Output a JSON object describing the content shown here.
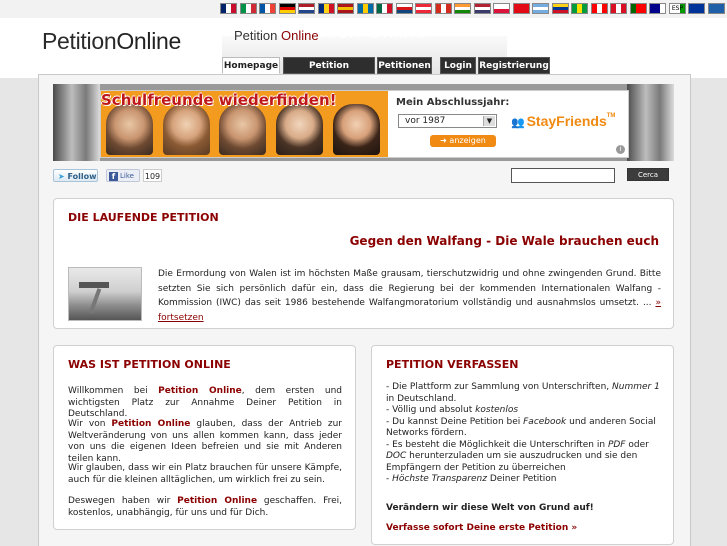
{
  "flags": [
    {
      "name": "uk-flag",
      "colors": [
        "#012169",
        "#ffffff",
        "#c8102e"
      ]
    },
    {
      "name": "italy-flag",
      "colors": [
        "#009246",
        "#ffffff",
        "#ce2b37"
      ]
    },
    {
      "name": "france-flag",
      "colors": [
        "#0055a4",
        "#ffffff",
        "#ef4135"
      ]
    },
    {
      "name": "germany-flag",
      "colors": [
        "#000000",
        "#dd0000",
        "#ffce00"
      ],
      "horizontal": true
    },
    {
      "name": "netherlands-flag",
      "colors": [
        "#ae1c28",
        "#ffffff",
        "#21468b"
      ],
      "horizontal": true
    },
    {
      "name": "romania-flag",
      "colors": [
        "#002b7f",
        "#fcd116",
        "#ce1126"
      ]
    },
    {
      "name": "spain-flag",
      "colors": [
        "#aa151b",
        "#f1bf00",
        "#aa151b"
      ],
      "horizontal": true
    },
    {
      "name": "sweden-flag",
      "colors": [
        "#006aa7",
        "#fecc00",
        "#006aa7"
      ]
    },
    {
      "name": "mexico-flag",
      "colors": [
        "#006847",
        "#ffffff",
        "#ce1126"
      ]
    },
    {
      "name": "czech-flag",
      "colors": [
        "#ffffff",
        "#d7141a",
        "#11457e"
      ],
      "horizontal": true
    },
    {
      "name": "austria-flag",
      "colors": [
        "#ed2939",
        "#ffffff",
        "#ed2939"
      ],
      "horizontal": true
    },
    {
      "name": "switzerland-flag",
      "colors": [
        "#d52b1e",
        "#ffffff",
        "#d52b1e"
      ]
    },
    {
      "name": "india-flag",
      "colors": [
        "#ff9933",
        "#ffffff",
        "#138808"
      ],
      "horizontal": true
    },
    {
      "name": "usa-flag",
      "colors": [
        "#b22234",
        "#ffffff",
        "#3c3b6e"
      ],
      "horizontal": true
    },
    {
      "name": "poland-flag",
      "colors": [
        "#ffffff",
        "#dc143c"
      ],
      "horizontal": true
    },
    {
      "name": "turkey-flag",
      "colors": [
        "#e30a17",
        "#e30a17",
        "#e30a17"
      ]
    },
    {
      "name": "argentina-flag",
      "colors": [
        "#74acdf",
        "#ffffff",
        "#74acdf"
      ],
      "horizontal": true
    },
    {
      "name": "colombia-flag",
      "colors": [
        "#fcd116",
        "#003893",
        "#ce1126"
      ],
      "horizontal": true
    },
    {
      "name": "brazil-flag",
      "colors": [
        "#009c3b",
        "#ffdf00",
        "#009c3b"
      ]
    },
    {
      "name": "canada-flag",
      "colors": [
        "#ff0000",
        "#ffffff",
        "#ff0000"
      ]
    },
    {
      "name": "peru-flag",
      "colors": [
        "#d91023",
        "#ffffff",
        "#d91023"
      ]
    },
    {
      "name": "portugal-flag",
      "colors": [
        "#006600",
        "#ff0000",
        "#ff0000"
      ]
    },
    {
      "name": "australia-flag",
      "colors": [
        "#00008b",
        "#00008b",
        "#ffffff"
      ]
    },
    {
      "name": "esperanto-flag",
      "colors": [
        "#ffffff",
        "#ffffff",
        "#009900"
      ],
      "label": "ESP"
    },
    {
      "name": "eu-flag",
      "colors": [
        "#003399",
        "#003399",
        "#003399"
      ]
    },
    {
      "name": "world-flag",
      "colors": [
        "#1f5fa8",
        "#1f5fa8",
        "#1f5fa8"
      ]
    }
  ],
  "header": {
    "logo_part1": "Petition",
    "logo_part2": "Online",
    "small_logo_part1": "Petition",
    "small_logo_part2": "Online",
    "ghost_logo": "Petition Online"
  },
  "tabs": [
    {
      "label": "Homepage",
      "active": true
    },
    {
      "label": "Petition verfassen",
      "active": false
    },
    {
      "label": "Petitionen",
      "active": false
    },
    {
      "label": "Login",
      "active": false
    },
    {
      "label": "Registrierung",
      "active": false
    }
  ],
  "ad": {
    "title": "Schulfreunde wiederfinden!",
    "label": "Mein Abschlussjahr:",
    "year": "vor 1987",
    "button": "anzeigen",
    "brand": "StayFriends",
    "brand_tm": "TM",
    "info": "i"
  },
  "social": {
    "follow": "Follow",
    "like": "Like",
    "like_count": "109"
  },
  "search": {
    "value": "",
    "button": "Cerca"
  },
  "current_petition": {
    "heading": "DIE LAUFENDE PETITION",
    "title": "Gegen den Walfang - Die Wale brauchen euch",
    "text": "Die Ermordung von Walen ist im höchsten Maße grausam, tierschutzwidrig und ohne zwingenden Grund. Bitte setzten Sie sich persönlich dafür ein, dass die Regierung bei der kommenden Internationalen Walfang - Kommission (IWC) das seit 1986 bestehende Walfangmoratorium vollständig und ausnahmslos umsetzt. ... ",
    "more_link": "» fortsetzen"
  },
  "about": {
    "heading": "WAS IST PETITION ONLINE",
    "brand": "Petition Online",
    "p1_before": "Willkommen bei ",
    "p1_after": ", dem ersten und wichtigsten Platz zur Annahme Deiner Petition in Deutschland.",
    "p2_before": "Wir von ",
    "p2_after": " glauben, dass der Antrieb zur Weltveränderung von uns allen kommen kann, dass jeder von uns die eigenen Ideen befreien und sie mit Anderen teilen kann.",
    "p3": "Wir glauben, dass wir ein Platz brauchen für unsere Kämpfe, auch für die kleinen alltäglichen, um wirklich frei zu sein.",
    "p4_before": "Deswegen haben wir ",
    "p4_after": " geschaffen. Frei, kostenlos, unabhängig, für uns und für Dich."
  },
  "create": {
    "heading": "PETITION VERFASSEN",
    "l1a": "- Die Plattform zur Sammlung von Unterschriften, ",
    "l1b": "Nummer 1",
    "l1c": " in Deutschland.",
    "l2a": "- Völlig und absolut ",
    "l2b": "kostenlos",
    "l3a": "- Du kannst Deine Petition bei ",
    "l3b": "Facebook",
    "l3c": " und anderen Social Networks fördern.",
    "l4a": "- Es besteht die Möglichkeit die Unterschriften in ",
    "l4b": "PDF",
    "l4c": " oder ",
    "l4d": "DOC",
    "l4e": " herunterzuladen um sie auszudrucken und sie den Empfängern der Petition zu überreichen",
    "l5a": "- ",
    "l5b": "Höchste Transparenz",
    "l5c": " Deiner Petition",
    "slogan": "Verändern wir diese Welt von Grund auf!",
    "link": "Verfasse sofort Deine erste Petition »"
  },
  "colors": {
    "accent": "#8b0000",
    "ad_orange": "#f39b1e",
    "tab_dark": "#2e2e2e"
  }
}
